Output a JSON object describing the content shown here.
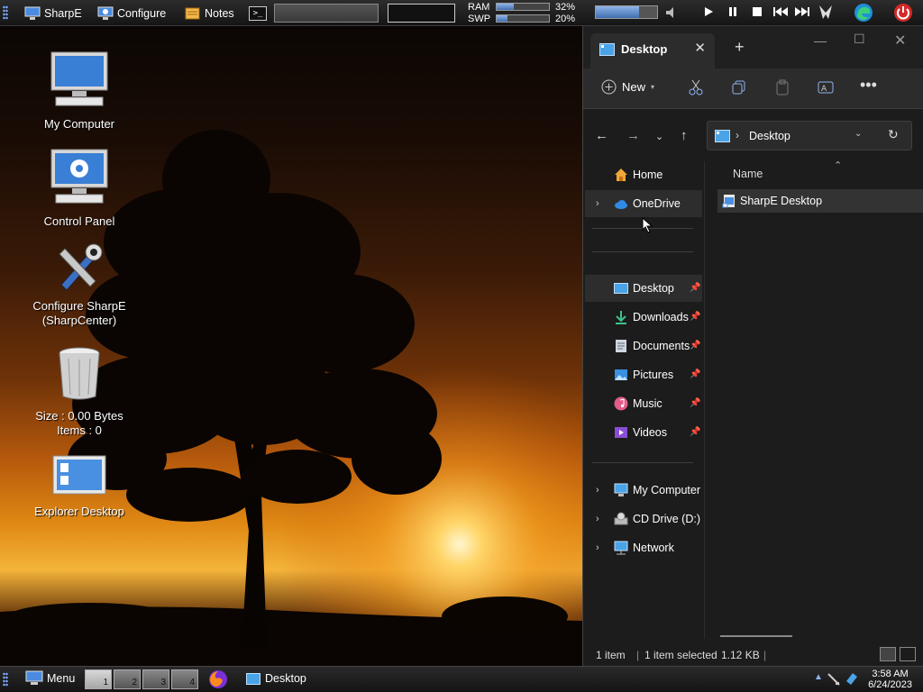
{
  "topbar": {
    "sharpe_label": "SharpE",
    "configure_label": "Configure",
    "notes_label": "Notes",
    "terminal_glyph": ">_",
    "ram_label": "RAM",
    "swp_label": "SWP",
    "ram_percent": "32%",
    "swp_percent": "20%",
    "ram_fill": 0.32,
    "swp_fill": 0.2,
    "volume_fill": 0.7
  },
  "desktop": {
    "icons": [
      {
        "label": "My Computer"
      },
      {
        "label": "Control Panel"
      },
      {
        "label": "Configure SharpE",
        "sublabel": "(SharpCenter)"
      },
      {
        "label": "Size : 0.00 Bytes",
        "sublabel": "Items : 0"
      },
      {
        "label": "Explorer Desktop"
      }
    ]
  },
  "explorer": {
    "tab_title": "Desktop",
    "new_button": "New",
    "address_path": "Desktop",
    "column_name": "Name",
    "nav": {
      "home": "Home",
      "onedrive": "OneDrive",
      "desktop": "Desktop",
      "downloads": "Downloads",
      "documents": "Documents",
      "pictures": "Pictures",
      "music": "Music",
      "videos": "Videos",
      "my_computer": "My Computer",
      "cd_drive": "CD Drive (D:)",
      "network": "Network"
    },
    "files": [
      {
        "name": "SharpE Desktop"
      }
    ],
    "status": {
      "count": "1 item",
      "selected": "1 item selected",
      "size": "1.12 KB"
    }
  },
  "taskbar": {
    "menu_label": "Menu",
    "workspaces": [
      "1",
      "2",
      "3",
      "4"
    ],
    "task_desktop": "Desktop",
    "time": "3:58 AM",
    "date": "6/24/2023"
  },
  "colors": {
    "accent_blue": "#4a90e2",
    "power_red": "#d42a2a"
  }
}
